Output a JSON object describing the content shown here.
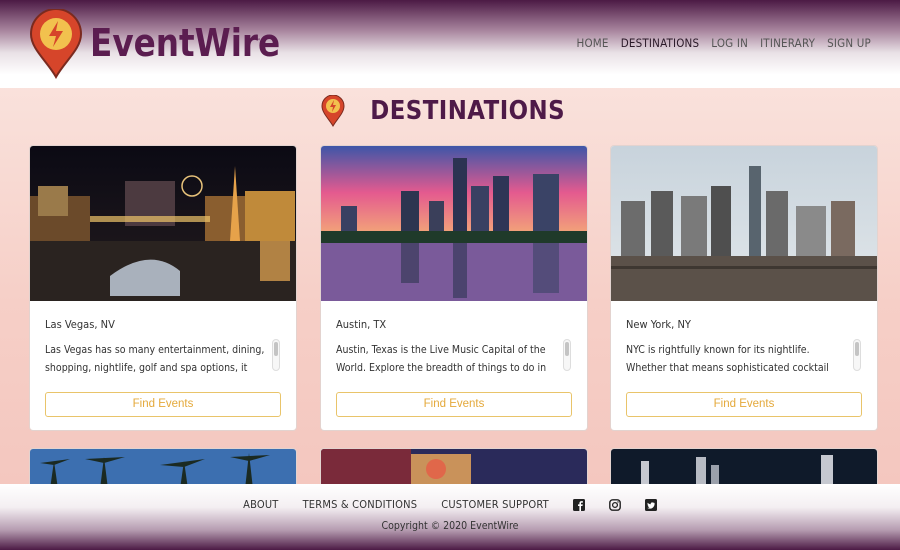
{
  "brand": {
    "name": "EventWire",
    "tm": "™"
  },
  "nav": {
    "items": [
      {
        "label": "HOME"
      },
      {
        "label": "DESTINATIONS"
      },
      {
        "label": "LOG IN"
      },
      {
        "label": "ITINERARY"
      },
      {
        "label": "SIGN UP"
      }
    ]
  },
  "page": {
    "title": "DESTINATIONS"
  },
  "cards": [
    {
      "title": "Las Vegas, NV",
      "desc": "Las Vegas has so many entertainment, dining, shopping, nightlife, golf and spa options, it can be",
      "button": "Find Events"
    },
    {
      "title": "Austin, TX",
      "desc": "Austin, Texas is the Live Music Capital of the World. Explore the breadth of things to do in Austin, from",
      "button": "Find Events"
    },
    {
      "title": "New York, NY",
      "desc": "NYC is rightfully known for its nightlife. Whether that means sophisticated cocktail dens, friendly",
      "button": "Find Events"
    }
  ],
  "footer": {
    "links": [
      {
        "label": "ABOUT"
      },
      {
        "label": "TERMS & CONDITIONS"
      },
      {
        "label": "CUSTOMER SUPPORT"
      }
    ],
    "social": [
      "facebook-icon",
      "instagram-icon",
      "twitter-icon"
    ],
    "copyright": "Copyright © 2020 EventWire"
  },
  "colors": {
    "brand_purple": "#5b1d50",
    "accent_orange": "#e4a93b",
    "pin_red": "#d6452a"
  }
}
